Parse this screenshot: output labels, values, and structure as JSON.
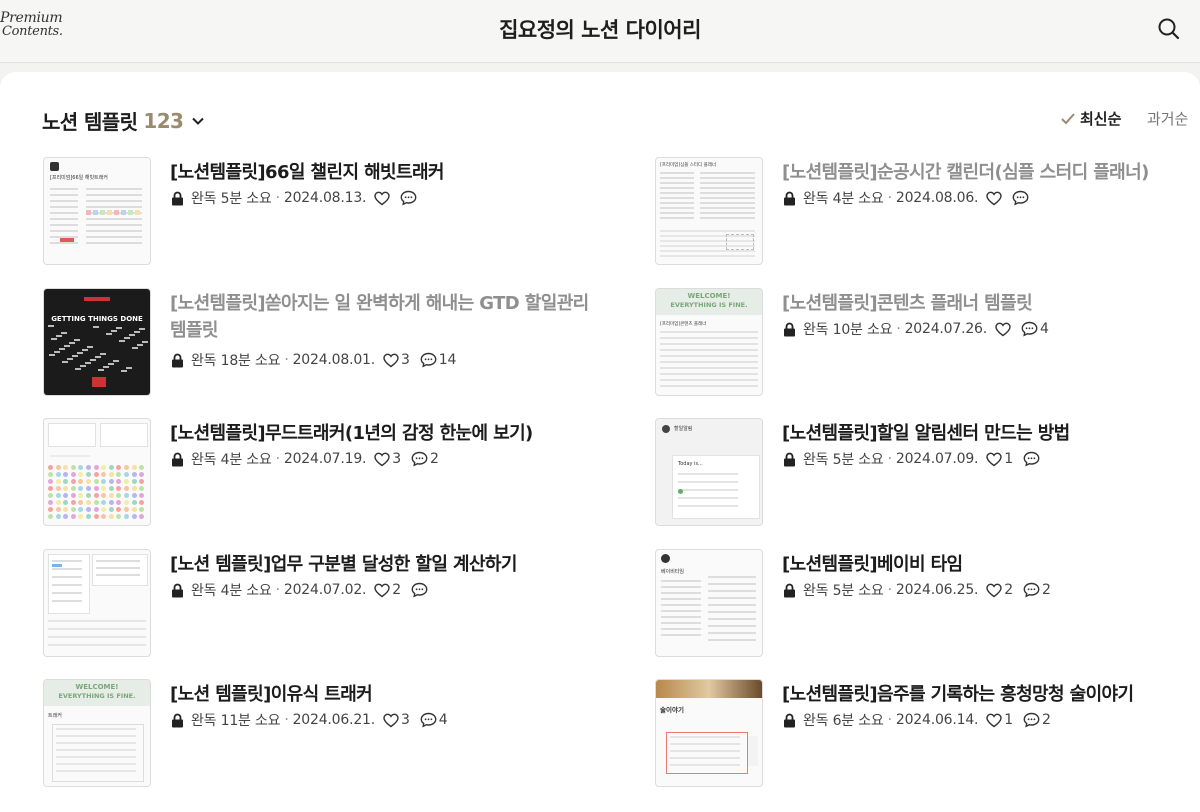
{
  "header": {
    "logo_line1": "Premium",
    "logo_line2": "Contents.",
    "title": "집요정의 노션 다이어리",
    "search_icon": "search-icon"
  },
  "category": {
    "name": "노션 템플릿",
    "count": "123"
  },
  "sort": {
    "newest": "최신순",
    "oldest": "과거순",
    "selected": "newest"
  },
  "posts": [
    {
      "title": "[노션템플릿]66일 챌린지 해빗트래커",
      "read": "완독 5분 소요",
      "date": "2024.08.13.",
      "likes": "",
      "comments": "",
      "title_color": "#1c1c1c"
    },
    {
      "title": "[노션템플릿]순공시간 캘린더(심플 스터디 플래너)",
      "read": "완독 4분 소요",
      "date": "2024.08.06.",
      "likes": "",
      "comments": "",
      "title_color": "#8f8f8f"
    },
    {
      "title": "[노션템플릿]쏟아지는 일 완벽하게 해내는 GTD 할일관리 템플릿",
      "read": "완독 18분 소요",
      "date": "2024.08.01.",
      "likes": "3",
      "comments": "14",
      "title_color": "#8f8f8f"
    },
    {
      "title": "[노션템플릿]콘텐츠 플래너 템플릿",
      "read": "완독 10분 소요",
      "date": "2024.07.26.",
      "likes": "",
      "comments": "4",
      "title_color": "#8f8f8f"
    },
    {
      "title": "[노션템플릿]무드트래커(1년의 감정 한눈에 보기)",
      "read": "완독 4분 소요",
      "date": "2024.07.19.",
      "likes": "3",
      "comments": "2",
      "title_color": "#1c1c1c"
    },
    {
      "title": "[노션템플릿]할일 알림센터 만드는 방법",
      "read": "완독 5분 소요",
      "date": "2024.07.09.",
      "likes": "1",
      "comments": "",
      "title_color": "#1c1c1c"
    },
    {
      "title": "[노션 템플릿]업무 구분별 달성한 할일 계산하기",
      "read": "완독 4분 소요",
      "date": "2024.07.02.",
      "likes": "2",
      "comments": "",
      "title_color": "#1c1c1c"
    },
    {
      "title": "[노션템플릿]베이비 타임",
      "read": "완독 5분 소요",
      "date": "2024.06.25.",
      "likes": "2",
      "comments": "2",
      "title_color": "#1c1c1c"
    },
    {
      "title": "[노션 템플릿]이유식 트래커",
      "read": "완독 11분 소요",
      "date": "2024.06.21.",
      "likes": "3",
      "comments": "4",
      "title_color": "#1c1c1c"
    },
    {
      "title": "[노션템플릿]음주를 기록하는 흥청망청 술이야기",
      "read": "완독 6분 소요",
      "date": "2024.06.14.",
      "likes": "1",
      "comments": "2",
      "title_color": "#1c1c1c"
    }
  ],
  "thumbs": {
    "habit": "[프리미엄]66일 해빗트래커",
    "study": "[프리미엄]심플 스터디 플래너",
    "gtd_title": "GETTING THINGS DONE",
    "welcome_l1": "WELCOME!",
    "welcome_l2": "EVERYTHING IS FINE.",
    "content_planner": "[프리미엄]콘텐츠 플래너",
    "alarm_title": "할일알림",
    "alarm_sub": "Today is...",
    "baby": "베이비타임",
    "drink": "술이야기",
    "baby_food": "트래커"
  },
  "icons": {
    "lock": "lock-icon",
    "like": "heart-icon",
    "comment": "comment-icon",
    "check": "check-icon",
    "chevron": "chevron-down-icon"
  }
}
